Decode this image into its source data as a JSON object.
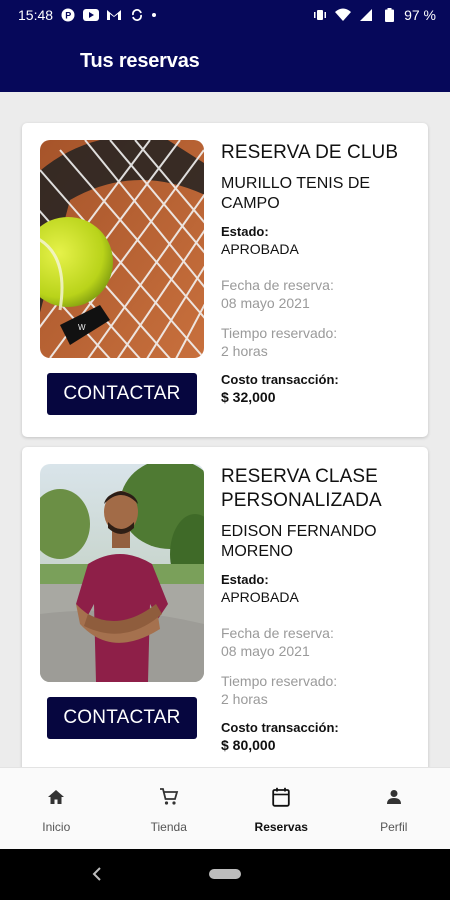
{
  "status_bar": {
    "time": "15:48",
    "battery": "97 %"
  },
  "app_bar": {
    "title": "Tus reservas"
  },
  "reservations": [
    {
      "type": "RESERVA DE CLUB",
      "name": "MURILLO TENIS DE CAMPO",
      "status_label": "Estado:",
      "status_value": "APROBADA",
      "date_label": "Fecha de reserva:",
      "date_value": "08 mayo 2021",
      "time_label": "Tiempo reservado:",
      "time_value": "2 horas",
      "cost_label": "Costo transacción:",
      "cost_value": "$ 32,000",
      "button_label": "CONTACTAR",
      "image": "tennis-ball-racket-photo"
    },
    {
      "type": "RESERVA CLASE PERSONALIZADA",
      "name": "EDISON FERNANDO MORENO",
      "status_label": "Estado:",
      "status_value": "APROBADA",
      "date_label": "Fecha de reserva:",
      "date_value": "08 mayo 2021",
      "time_label": "Tiempo reservado:",
      "time_value": "2 horas",
      "cost_label": "Costo transacción:",
      "cost_value": "$ 80,000",
      "button_label": "CONTACTAR",
      "image": "instructor-portrait-photo"
    }
  ],
  "bottom_nav": {
    "items": [
      {
        "label": "Inicio",
        "icon": "home-icon"
      },
      {
        "label": "Tienda",
        "icon": "cart-icon"
      },
      {
        "label": "Reservas",
        "icon": "calendar-icon",
        "active": true
      },
      {
        "label": "Perfil",
        "icon": "person-icon"
      }
    ]
  },
  "colors": {
    "primary": "#06085a",
    "button": "#06063f",
    "background": "#ececec",
    "muted_text": "#9a9a9a"
  }
}
